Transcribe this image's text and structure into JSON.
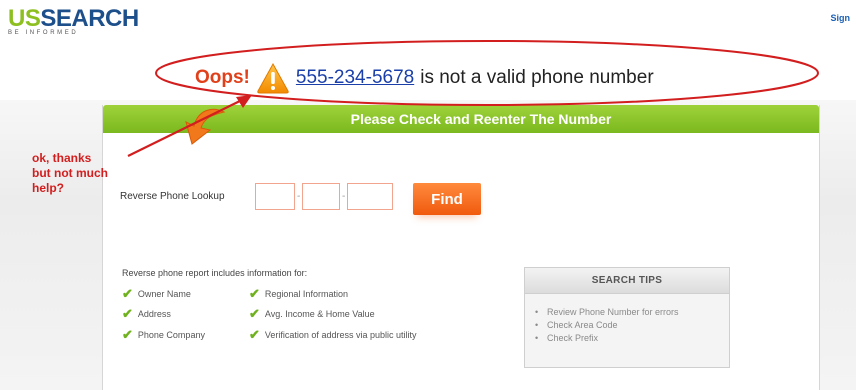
{
  "header": {
    "logo_us": "US",
    "logo_search": "SEARCH",
    "logo_tagline": "BE INFORMED",
    "signin_label": "Sign"
  },
  "error": {
    "oops": "Oops!",
    "phone": "555-234-5678",
    "message": "is not a valid phone number"
  },
  "annotation": {
    "text": "ok, thanks\nbut not much\nhelp?"
  },
  "panel": {
    "title": "Please Check and Reenter The Number"
  },
  "lookup": {
    "label": "Reverse Phone Lookup",
    "find_label": "Find"
  },
  "report": {
    "intro": "Reverse phone report includes information for:",
    "col1": [
      "Owner Name",
      "Address",
      "Phone Company"
    ],
    "col2": [
      "Regional Information",
      "Avg. Income & Home Value",
      "Verification of address via public utility"
    ]
  },
  "tips": {
    "title": "SEARCH TIPS",
    "items": [
      "Review Phone Number for errors",
      "Check Area Code",
      "Check Prefix"
    ]
  },
  "icons": {
    "warning": "warning-triangle-icon",
    "check": "check-icon",
    "curved_arrow": "curved-arrow-icon"
  },
  "colors": {
    "brand_green": "#8cbf1f",
    "brand_blue": "#1d4f8b",
    "error_orange": "#e0411b",
    "annotation_red": "#d21e1e",
    "button_orange": "#f05a0e"
  }
}
